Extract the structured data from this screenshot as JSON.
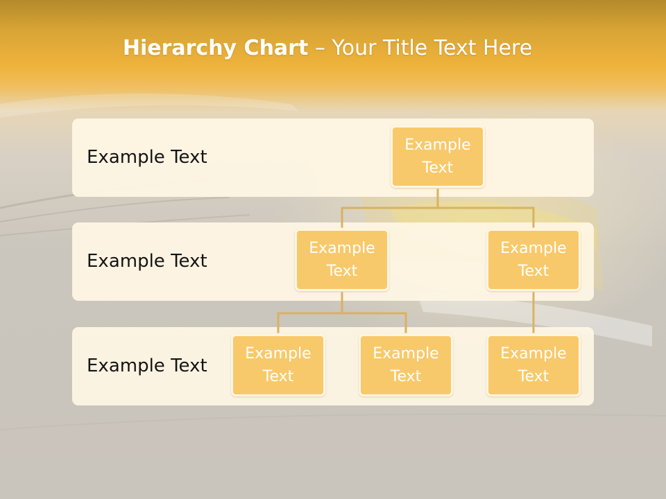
{
  "title": {
    "bold": "Hierarchy Chart",
    "rest": " – Your Title Text Here"
  },
  "levels": [
    {
      "label": "Example Text"
    },
    {
      "label": "Example Text"
    },
    {
      "label": "Example Text"
    }
  ],
  "nodes": {
    "root": "Example Text",
    "level2_left": "Example Text",
    "level2_right": "Example Text",
    "level3_left": "Example Text",
    "level3_middle": "Example Text",
    "level3_right": "Example Text"
  },
  "colors": {
    "header": "#efb33c",
    "band": "#fff6e4",
    "node_fill": "#f8c96a",
    "node_border": "#fff6e2",
    "connector": "#d9b262",
    "node_text": "#ffffff",
    "label_text": "#141414"
  }
}
